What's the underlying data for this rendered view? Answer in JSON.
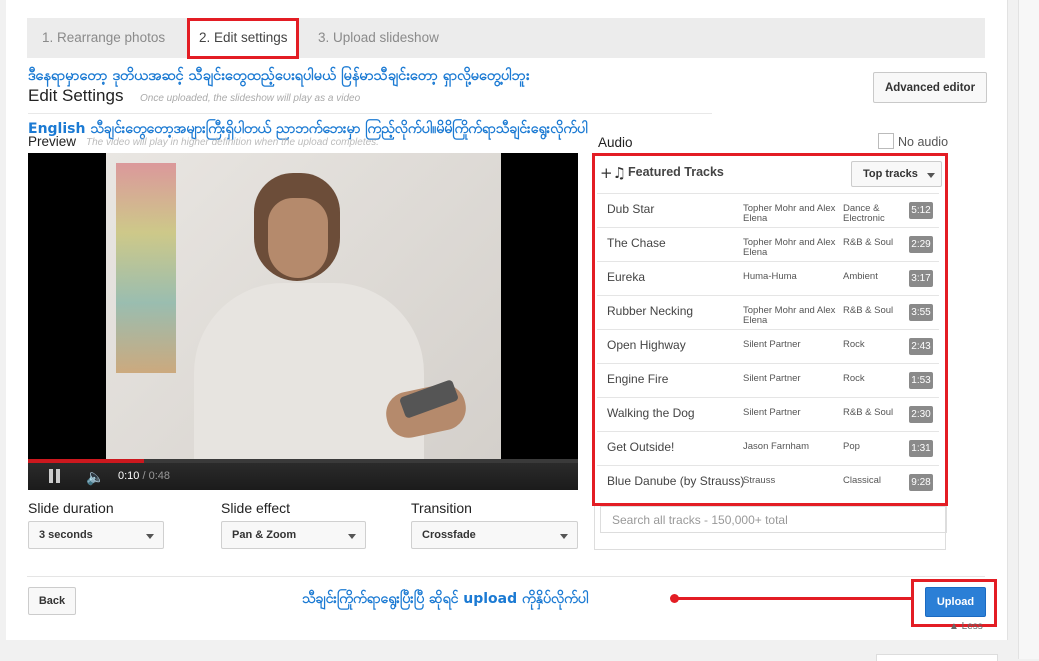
{
  "tabs": [
    {
      "label": "1. Rearrange photos"
    },
    {
      "label": "2. Edit settings"
    },
    {
      "label": "3. Upload slideshow"
    }
  ],
  "annotations": {
    "top": "ဒီနေရာမှာတော့ ဒုတိယအဆင့် သီချင်းတွေထည့်ပေးရပါမယ် မြန်မာသီချင်းတော့ ရှာလို့မတွေ့ပါဘူး",
    "middle": "English သီချင်းတွေတော့အများကြီးရှိပါတယ် ညာဘက်ဘေးမှာ ကြည့်လိုက်ပါ။မိမိကြိုက်ရာသီချင်းရွေးလိုက်ပါ",
    "bottom": "သီချင်းကြိုက်ရာရွေးပြီးပြီ ဆိုရင် upload ကိုနှိပ်လိုက်ပါ"
  },
  "header": {
    "advanced_editor": "Advanced editor",
    "title": "Edit Settings",
    "subtitle": "Once uploaded, the slideshow will play as a video"
  },
  "preview": {
    "label": "Preview",
    "note": "The video will play in higher definition when the upload completes.",
    "time_current": "0:10",
    "time_total": " / 0:48",
    "progress": 0.21
  },
  "settings": {
    "slide_duration_label": "Slide duration",
    "slide_duration_value": "3 seconds",
    "slide_effect_label": "Slide effect",
    "slide_effect_value": "Pan & Zoom",
    "transition_label": "Transition",
    "transition_value": "Crossfade"
  },
  "audio": {
    "label": "Audio",
    "no_audio": "No audio",
    "featured_title": "Featured Tracks",
    "top_tracks": "Top tracks",
    "search_placeholder": "Search all tracks - 150,000+ total",
    "tracks": [
      {
        "name": "Dub Star",
        "artist": "Topher Mohr and Alex Elena",
        "genre": "Dance & Electronic",
        "duration": "5:12"
      },
      {
        "name": "The Chase",
        "artist": "Topher Mohr and Alex Elena",
        "genre": "R&B & Soul",
        "duration": "2:29"
      },
      {
        "name": "Eureka",
        "artist": "Huma-Huma",
        "genre": "Ambient",
        "duration": "3:17"
      },
      {
        "name": "Rubber Necking",
        "artist": "Topher Mohr and Alex Elena",
        "genre": "R&B & Soul",
        "duration": "3:55"
      },
      {
        "name": "Open Highway",
        "artist": "Silent Partner",
        "genre": "Rock",
        "duration": "2:43"
      },
      {
        "name": "Engine Fire",
        "artist": "Silent Partner",
        "genre": "Rock",
        "duration": "1:53"
      },
      {
        "name": "Walking the Dog",
        "artist": "Silent Partner",
        "genre": "R&B & Soul",
        "duration": "2:30"
      },
      {
        "name": "Get Outside!",
        "artist": "Jason Farnham",
        "genre": "Pop",
        "duration": "1:31"
      },
      {
        "name": "Blue Danube (by Strauss)",
        "artist": "Strauss",
        "genre": "Classical",
        "duration": "9:28"
      }
    ]
  },
  "footer": {
    "back": "Back",
    "upload": "Upload",
    "less": "▲ Less"
  },
  "colors": {
    "highlight": "#e31d24",
    "annotation": "#1b7ad3",
    "upload_button": "#2b7fd6"
  }
}
